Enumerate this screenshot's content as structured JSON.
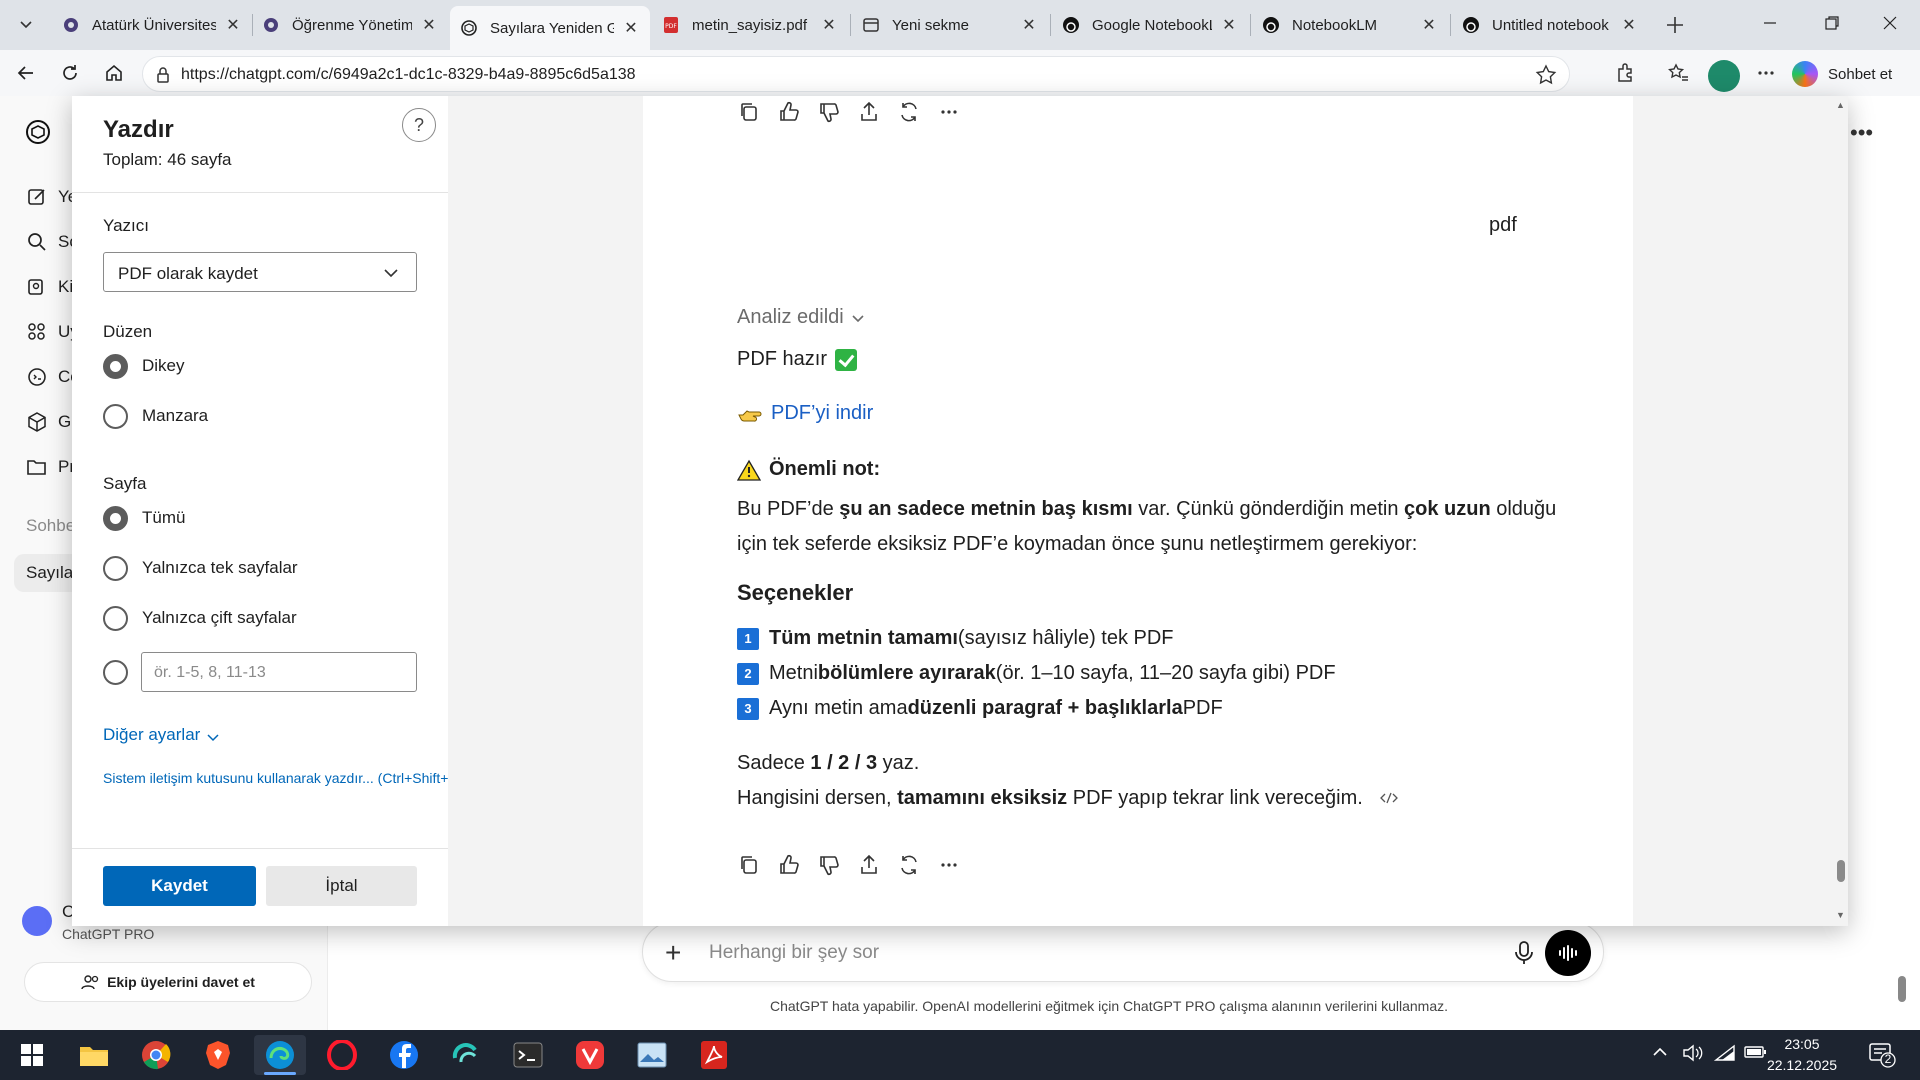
{
  "browser": {
    "tabs": [
      {
        "label": "Atatürk Üniversitesi",
        "icon": "circle-icon",
        "active": false
      },
      {
        "label": "Öğrenme Yönetim S",
        "icon": "circle-icon",
        "active": false
      },
      {
        "label": "Sayılara Yeniden Gö",
        "icon": "chatgpt-icon",
        "active": true
      },
      {
        "label": "metin_sayisiz.pdf",
        "icon": "pdf-icon",
        "active": false
      },
      {
        "label": "Yeni sekme",
        "icon": "newtab-icon",
        "active": false
      },
      {
        "label": "Google NotebookLM",
        "icon": "notebooklm-icon",
        "active": false
      },
      {
        "label": "NotebookLM",
        "icon": "notebooklm-icon",
        "active": false
      },
      {
        "label": "Untitled notebook",
        "icon": "notebooklm-icon",
        "active": false
      }
    ],
    "url": "https://chatgpt.com/c/6949a2c1-dc1c-8329-b4a9-8895c6d5a138",
    "copilot_label": "Sohbet et"
  },
  "chatgpt": {
    "sidebar_items": [
      "Ye",
      "Sc",
      "Ki",
      "Uy",
      "Co",
      "Gl",
      "Pr"
    ],
    "section_label": "Sohbe",
    "active_chat": "Sayılar",
    "user_initial": "C",
    "plan": "ChatGPT PRO",
    "invite_label": "Ekip üyelerini davet et",
    "composer_placeholder": "Herhangi bir şey sor",
    "disclaimer": "ChatGPT hata yapabilir. OpenAI modellerini eğitmek için ChatGPT PRO çalışma alanının verilerini kullanmaz."
  },
  "print": {
    "title": "Yazdır",
    "total": "Toplam: 46 sayfa",
    "printer_label": "Yazıcı",
    "printer_value": "PDF olarak kaydet",
    "layout_label": "Düzen",
    "layout_options": [
      "Dikey",
      "Manzara"
    ],
    "layout_selected": "Dikey",
    "pages_label": "Sayfa",
    "pages_options": [
      "Tümü",
      "Yalnızca tek sayfalar",
      "Yalnızca çift sayfalar"
    ],
    "pages_selected": "Tümü",
    "range_placeholder": "ör. 1-5, 8, 11-13",
    "more_settings": "Diğer ayarlar",
    "system_dialog": "Sistem iletişim kutusunu kullanarak yazdır... (Ctrl+Shift+P)",
    "save_button": "Kaydet",
    "cancel_button": "İptal"
  },
  "preview": {
    "pdf_word": "pdf",
    "analyzed": "Analiz edildi",
    "pdf_ready": "PDF hazır",
    "download_link": "PDF’yi indir",
    "note_title": "Önemli not:",
    "note_body_1": "Bu PDF’de ",
    "note_bold_1": "şu an sadece metnin baş kısmı",
    "note_body_2": " var. Çünkü gönderdiğin metin ",
    "note_bold_2": "çok uzun",
    "note_body_3": " olduğu için tek seferde eksiksiz PDF’e koymadan önce şunu netleştirmem gerekiyor:",
    "options_title": "Seçenekler",
    "options": [
      {
        "num": "1",
        "bold": "Tüm metnin tamamı",
        "rest": " (sayısız hâliyle) tek PDF",
        "pre": ""
      },
      {
        "num": "2",
        "pre": "Metni ",
        "bold": "bölümlere ayırarak",
        "rest": " (ör. 1–10 sayfa, 11–20 sayfa gibi) PDF"
      },
      {
        "num": "3",
        "pre": "Aynı metin ama ",
        "bold": "düzenli paragraf + başlıklarla",
        "rest": " PDF"
      }
    ],
    "only_pre": "Sadece ",
    "only_bold": "1 / 2 / 3",
    "only_post": " yaz.",
    "which_pre": "Hangisini dersen, ",
    "which_bold": "tamamını eksiksiz",
    "which_post": " PDF yapıp tekrar link vereceğim."
  },
  "taskbar": {
    "time": "23:05",
    "date": "22.12.2025",
    "notifications": "2"
  }
}
